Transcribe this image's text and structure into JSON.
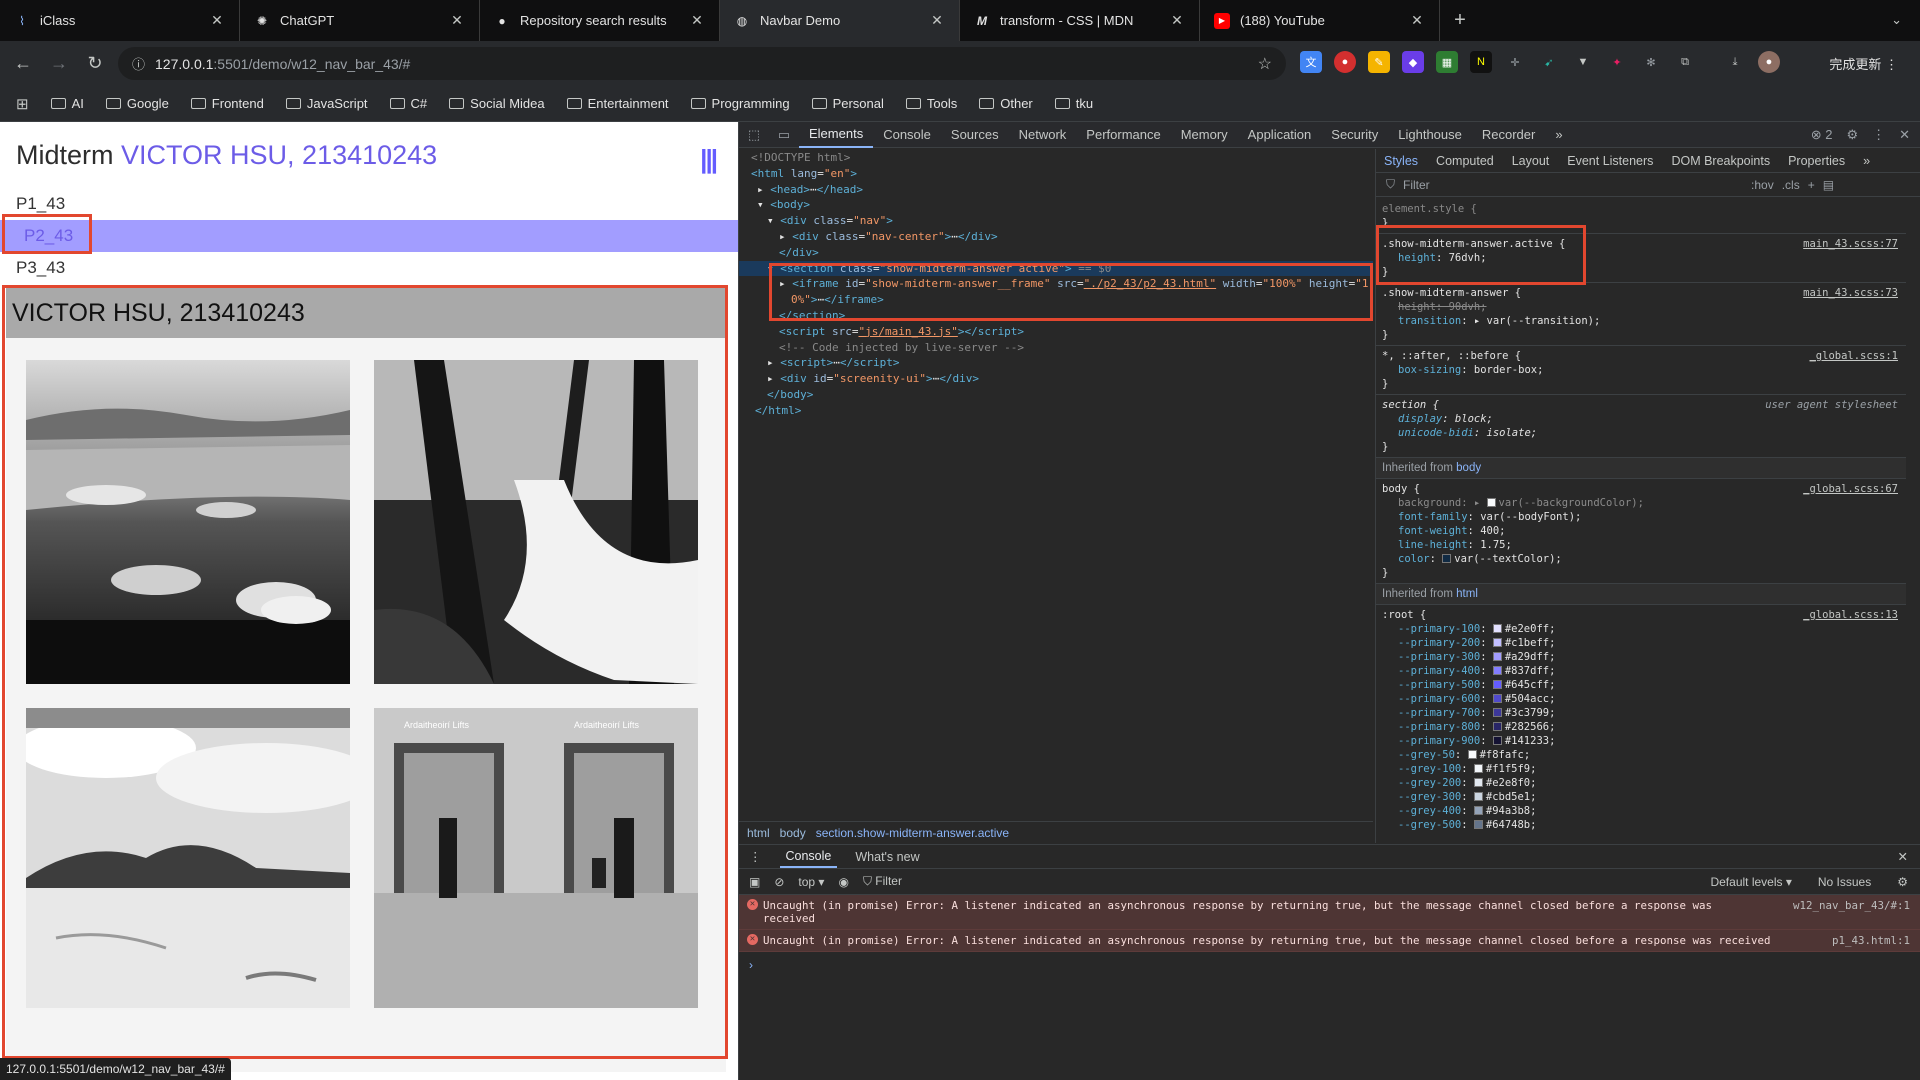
{
  "tabs": [
    {
      "title": "iClass",
      "icon": "iclass-icon"
    },
    {
      "title": "ChatGPT",
      "icon": "chatgpt-icon"
    },
    {
      "title": "Repository search results",
      "icon": "github-icon"
    },
    {
      "title": "Navbar Demo",
      "icon": "globe-icon"
    },
    {
      "title": "transform - CSS | MDN",
      "icon": "mdn-icon"
    },
    {
      "title": "(188) YouTube",
      "icon": "youtube-icon"
    }
  ],
  "toolbar": {
    "url_host": "127.0.0.1",
    "url_path": ":5501/demo/w12_nav_bar_43/#",
    "update_label": "完成更新"
  },
  "bookmarks": [
    "AI",
    "Google",
    "Frontend",
    "JavaScript",
    "C#",
    "Social Midea",
    "Entertainment",
    "Programming",
    "Personal",
    "Tools",
    "Other",
    "tku"
  ],
  "page": {
    "title_prefix": "Midterm",
    "title_name": "VICTOR HSU, 213410243",
    "nav_items": [
      "P1_43",
      "P2_43",
      "P3_43"
    ],
    "section_title": "VICTOR HSU, 213410243",
    "lift_sign": "Ardaitheoirí Lifts"
  },
  "status_url": "127.0.0.1:5501/demo/w12_nav_bar_43/#",
  "devtools": {
    "tabs": [
      "Elements",
      "Console",
      "Sources",
      "Network",
      "Performance",
      "Memory",
      "Application",
      "Security",
      "Lighthouse",
      "Recorder"
    ],
    "issue_count": "2",
    "breadcrumbs": [
      "html",
      "body",
      "section.show-midterm-answer.active"
    ],
    "styles_tabs": [
      "Styles",
      "Computed",
      "Layout",
      "Event Listeners",
      "DOM Breakpoints",
      "Properties"
    ],
    "filter_placeholder": "Filter",
    "hov": ":hov",
    "cls": ".cls",
    "console_tabs": [
      "Console",
      "What's new"
    ],
    "console_context": "top",
    "console_filter": "Filter",
    "default_levels": "Default levels",
    "no_issues": "No Issues",
    "errors": [
      {
        "text": "Uncaught (in promise) Error: A listener indicated an asynchronous response by returning true, but the message channel closed before a response was received",
        "source": "w12_nav_bar_43/#:1"
      },
      {
        "text": "Uncaught (in promise) Error: A listener indicated an asynchronous response by returning true, but the message channel closed before a response was received",
        "source": "p1_43.html:1"
      }
    ],
    "root_vars": [
      {
        "name": "--primary-100",
        "value": "#e2e0ff"
      },
      {
        "name": "--primary-200",
        "value": "#c1beff"
      },
      {
        "name": "--primary-300",
        "value": "#a29dff"
      },
      {
        "name": "--primary-400",
        "value": "#837dff"
      },
      {
        "name": "--primary-500",
        "value": "#645cff"
      },
      {
        "name": "--primary-600",
        "value": "#504acc"
      },
      {
        "name": "--primary-700",
        "value": "#3c3799"
      },
      {
        "name": "--primary-800",
        "value": "#282566"
      },
      {
        "name": "--primary-900",
        "value": "#141233"
      },
      {
        "name": "--grey-50",
        "value": "#f8fafc"
      },
      {
        "name": "--grey-100",
        "value": "#f1f5f9"
      },
      {
        "name": "--grey-200",
        "value": "#e2e8f0"
      },
      {
        "name": "--grey-300",
        "value": "#cbd5e1"
      },
      {
        "name": "--grey-400",
        "value": "#94a3b8"
      },
      {
        "name": "--grey-500",
        "value": "#64748b"
      }
    ]
  },
  "colors": {
    "accent": "#645cff",
    "highlight": "#a29dff",
    "annotation": "#e2472f"
  }
}
